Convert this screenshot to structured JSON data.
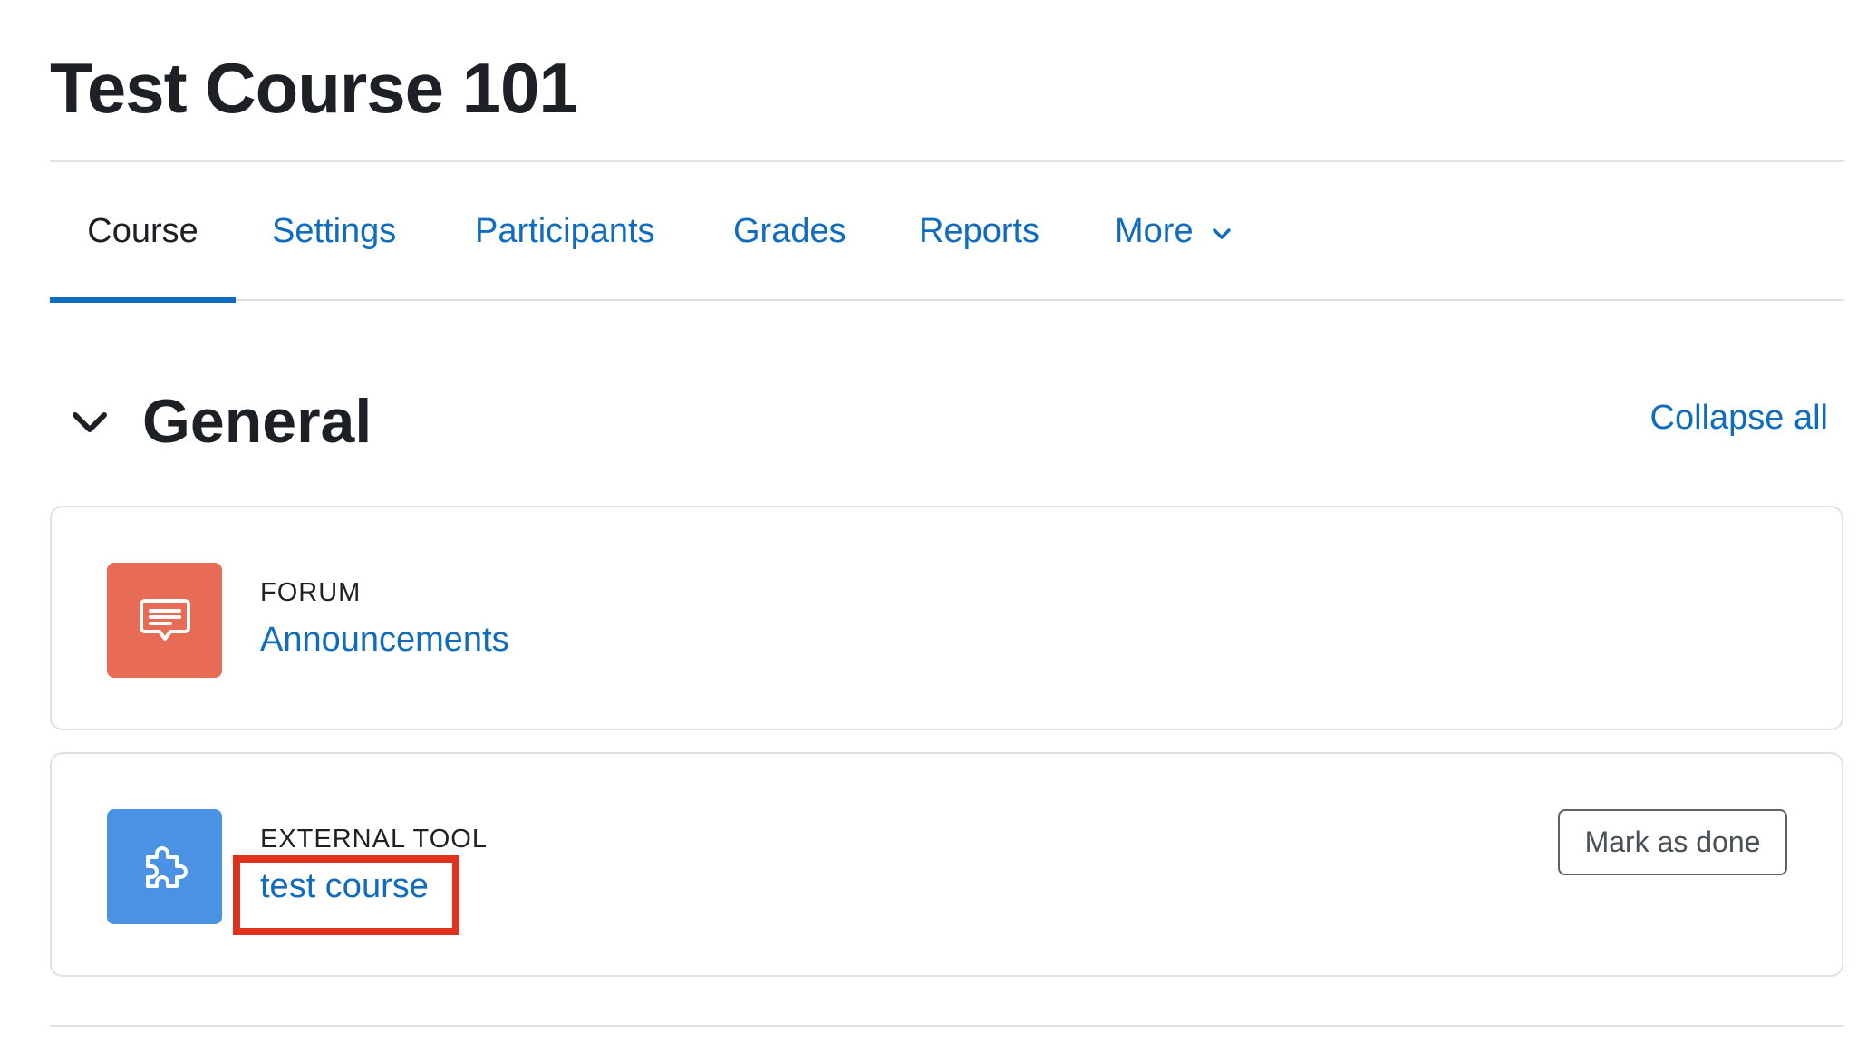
{
  "course": {
    "title": "Test Course 101"
  },
  "tabs": [
    {
      "label": "Course",
      "active": true
    },
    {
      "label": "Settings",
      "active": false
    },
    {
      "label": "Participants",
      "active": false
    },
    {
      "label": "Grades",
      "active": false
    },
    {
      "label": "Reports",
      "active": false
    },
    {
      "label": "More",
      "active": false,
      "icon": "chevron-down-icon"
    }
  ],
  "section": {
    "title": "General",
    "toggle_icon": "chevron-down-icon",
    "collapse_all_label": "Collapse all"
  },
  "activities": [
    {
      "type": "FORUM",
      "name": "Announcements",
      "icon": "forum-speech-bubble-icon",
      "icon_color": "#e86b55"
    },
    {
      "type": "EXTERNAL TOOL",
      "name": "test course",
      "icon": "puzzle-piece-icon",
      "icon_color": "#4a93e4",
      "completion_button_label": "Mark as done"
    }
  ],
  "colors": {
    "link": "#0f6cbf",
    "text": "#1d2125",
    "border": "#dee2e6",
    "highlight": "#e0331f"
  }
}
